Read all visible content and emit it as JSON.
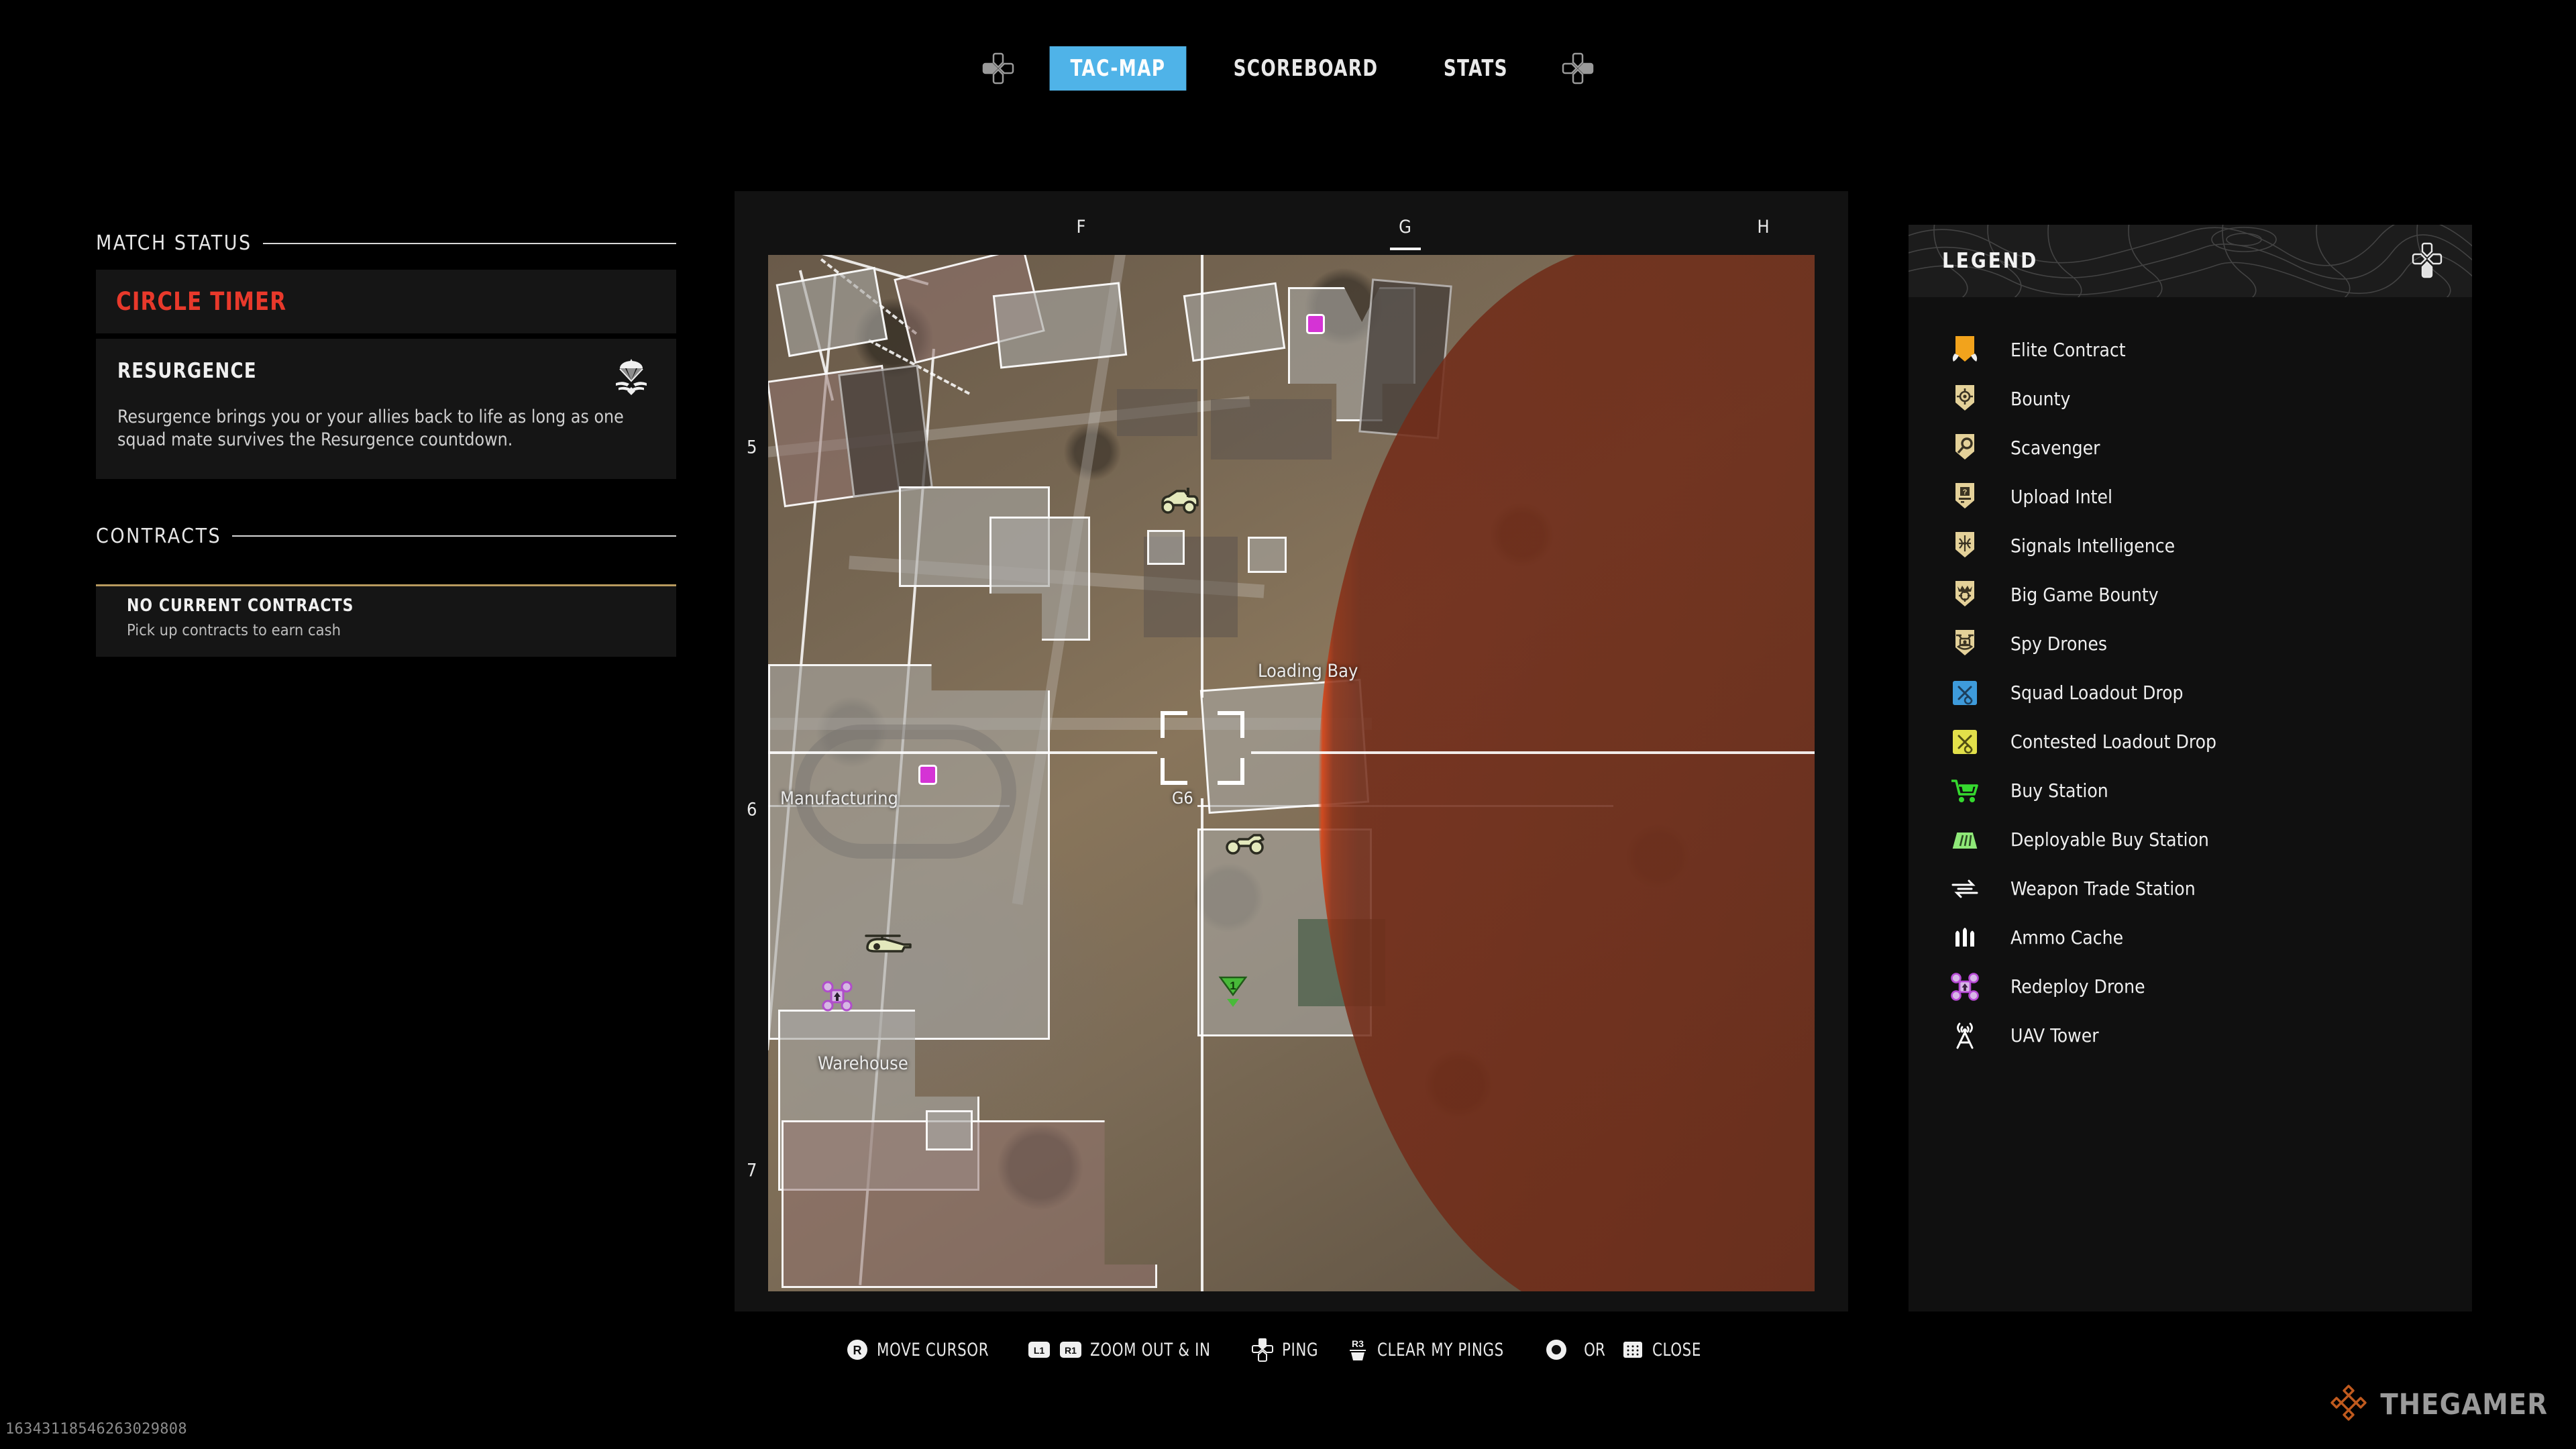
{
  "nav": {
    "left_dpad_icon": "dpad-left-icon",
    "right_dpad_icon": "dpad-right-icon",
    "tabs": [
      {
        "label": "TAC-MAP",
        "active": true
      },
      {
        "label": "SCOREBOARD",
        "active": false
      },
      {
        "label": "STATS",
        "active": false
      }
    ],
    "active_color": "#4FB3E8"
  },
  "left_panel": {
    "match_status_heading": "MATCH STATUS",
    "circle_timer_label": "CIRCLE TIMER",
    "circle_timer_color": "#E8392B",
    "mode": {
      "title": "RESURGENCE",
      "icon": "parachute-wings-icon",
      "description": "Resurgence brings you or your allies back to life as long as one squad mate survives the Resurgence countdown."
    },
    "contracts_heading": "CONTRACTS",
    "contract": {
      "title": "NO CURRENT CONTRACTS",
      "subtitle": "Pick up contracts to earn cash",
      "accent_color": "#B89A5E"
    }
  },
  "map": {
    "column_labels": [
      "F",
      "G",
      "H"
    ],
    "row_labels": [
      "5",
      "6",
      "7"
    ],
    "place_labels": [
      "Loading Bay",
      "Manufacturing",
      "Warehouse"
    ],
    "cursor_coordinate": "G6",
    "gas_zone_color": "#E04515",
    "ping_color": "#E22EE2",
    "teammate_marker": {
      "label": "1",
      "color": "#3FBE2E"
    },
    "vehicles": [
      "buggy-icon",
      "motorcycle-icon",
      "helicopter-icon"
    ],
    "markers": [
      "redeploy-drone-icon"
    ]
  },
  "legend": {
    "title": "LEGEND",
    "dpad_icon": "dpad-down-icon",
    "items": [
      {
        "label": "Elite Contract",
        "icon": "elite-contract-icon",
        "color": "#F2A31C"
      },
      {
        "label": "Bounty",
        "icon": "bounty-icon",
        "color": "#E4D199"
      },
      {
        "label": "Scavenger",
        "icon": "scavenger-icon",
        "color": "#E4D199"
      },
      {
        "label": "Upload Intel",
        "icon": "upload-intel-icon",
        "color": "#E4D199"
      },
      {
        "label": "Signals Intelligence",
        "icon": "signals-intelligence-icon",
        "color": "#E4D199"
      },
      {
        "label": "Big Game Bounty",
        "icon": "big-game-bounty-icon",
        "color": "#E4D199"
      },
      {
        "label": "Spy Drones",
        "icon": "spy-drones-icon",
        "color": "#E4D199"
      },
      {
        "label": "Squad Loadout Drop",
        "icon": "squad-loadout-drop-icon",
        "color": "#3E9BDB"
      },
      {
        "label": "Contested Loadout Drop",
        "icon": "contested-loadout-drop-icon",
        "color": "#E2E04A"
      },
      {
        "label": "Buy Station",
        "icon": "buy-station-icon",
        "color": "#35D92F"
      },
      {
        "label": "Deployable Buy Station",
        "icon": "deployable-buy-station-icon",
        "color": "#8FE878"
      },
      {
        "label": "Weapon Trade Station",
        "icon": "weapon-trade-station-icon",
        "color": "#FFFFFF"
      },
      {
        "label": "Ammo Cache",
        "icon": "ammo-cache-icon",
        "color": "#FFFFFF"
      },
      {
        "label": "Redeploy Drone",
        "icon": "redeploy-drone-icon",
        "color": "#B84AD6"
      },
      {
        "label": "UAV Tower",
        "icon": "uav-tower-icon",
        "color": "#FFFFFF"
      }
    ]
  },
  "bottom_bar": {
    "hints": [
      {
        "glyph": "R",
        "glyph_kind": "stick",
        "label": "MOVE CURSOR"
      },
      {
        "glyph": "L1 R1",
        "glyph_kind": "shoulder-pair",
        "label": "ZOOM OUT & IN"
      },
      {
        "glyph": "dpad",
        "glyph_kind": "dpad",
        "label": "PING"
      },
      {
        "glyph": "R3",
        "glyph_kind": "stick-press",
        "label": "CLEAR MY PINGS"
      },
      {
        "glyph": "circle",
        "glyph_kind": "circle-button",
        "label": "CLOSE",
        "or_word": "OR",
        "glyph2": "touchpad"
      }
    ]
  },
  "watermarks": {
    "id_code": "16343118546263029808",
    "brand_text": "THEGAMER",
    "brand_icon": "thegamer-diamond-icon",
    "brand_color": "#C05A1E"
  }
}
